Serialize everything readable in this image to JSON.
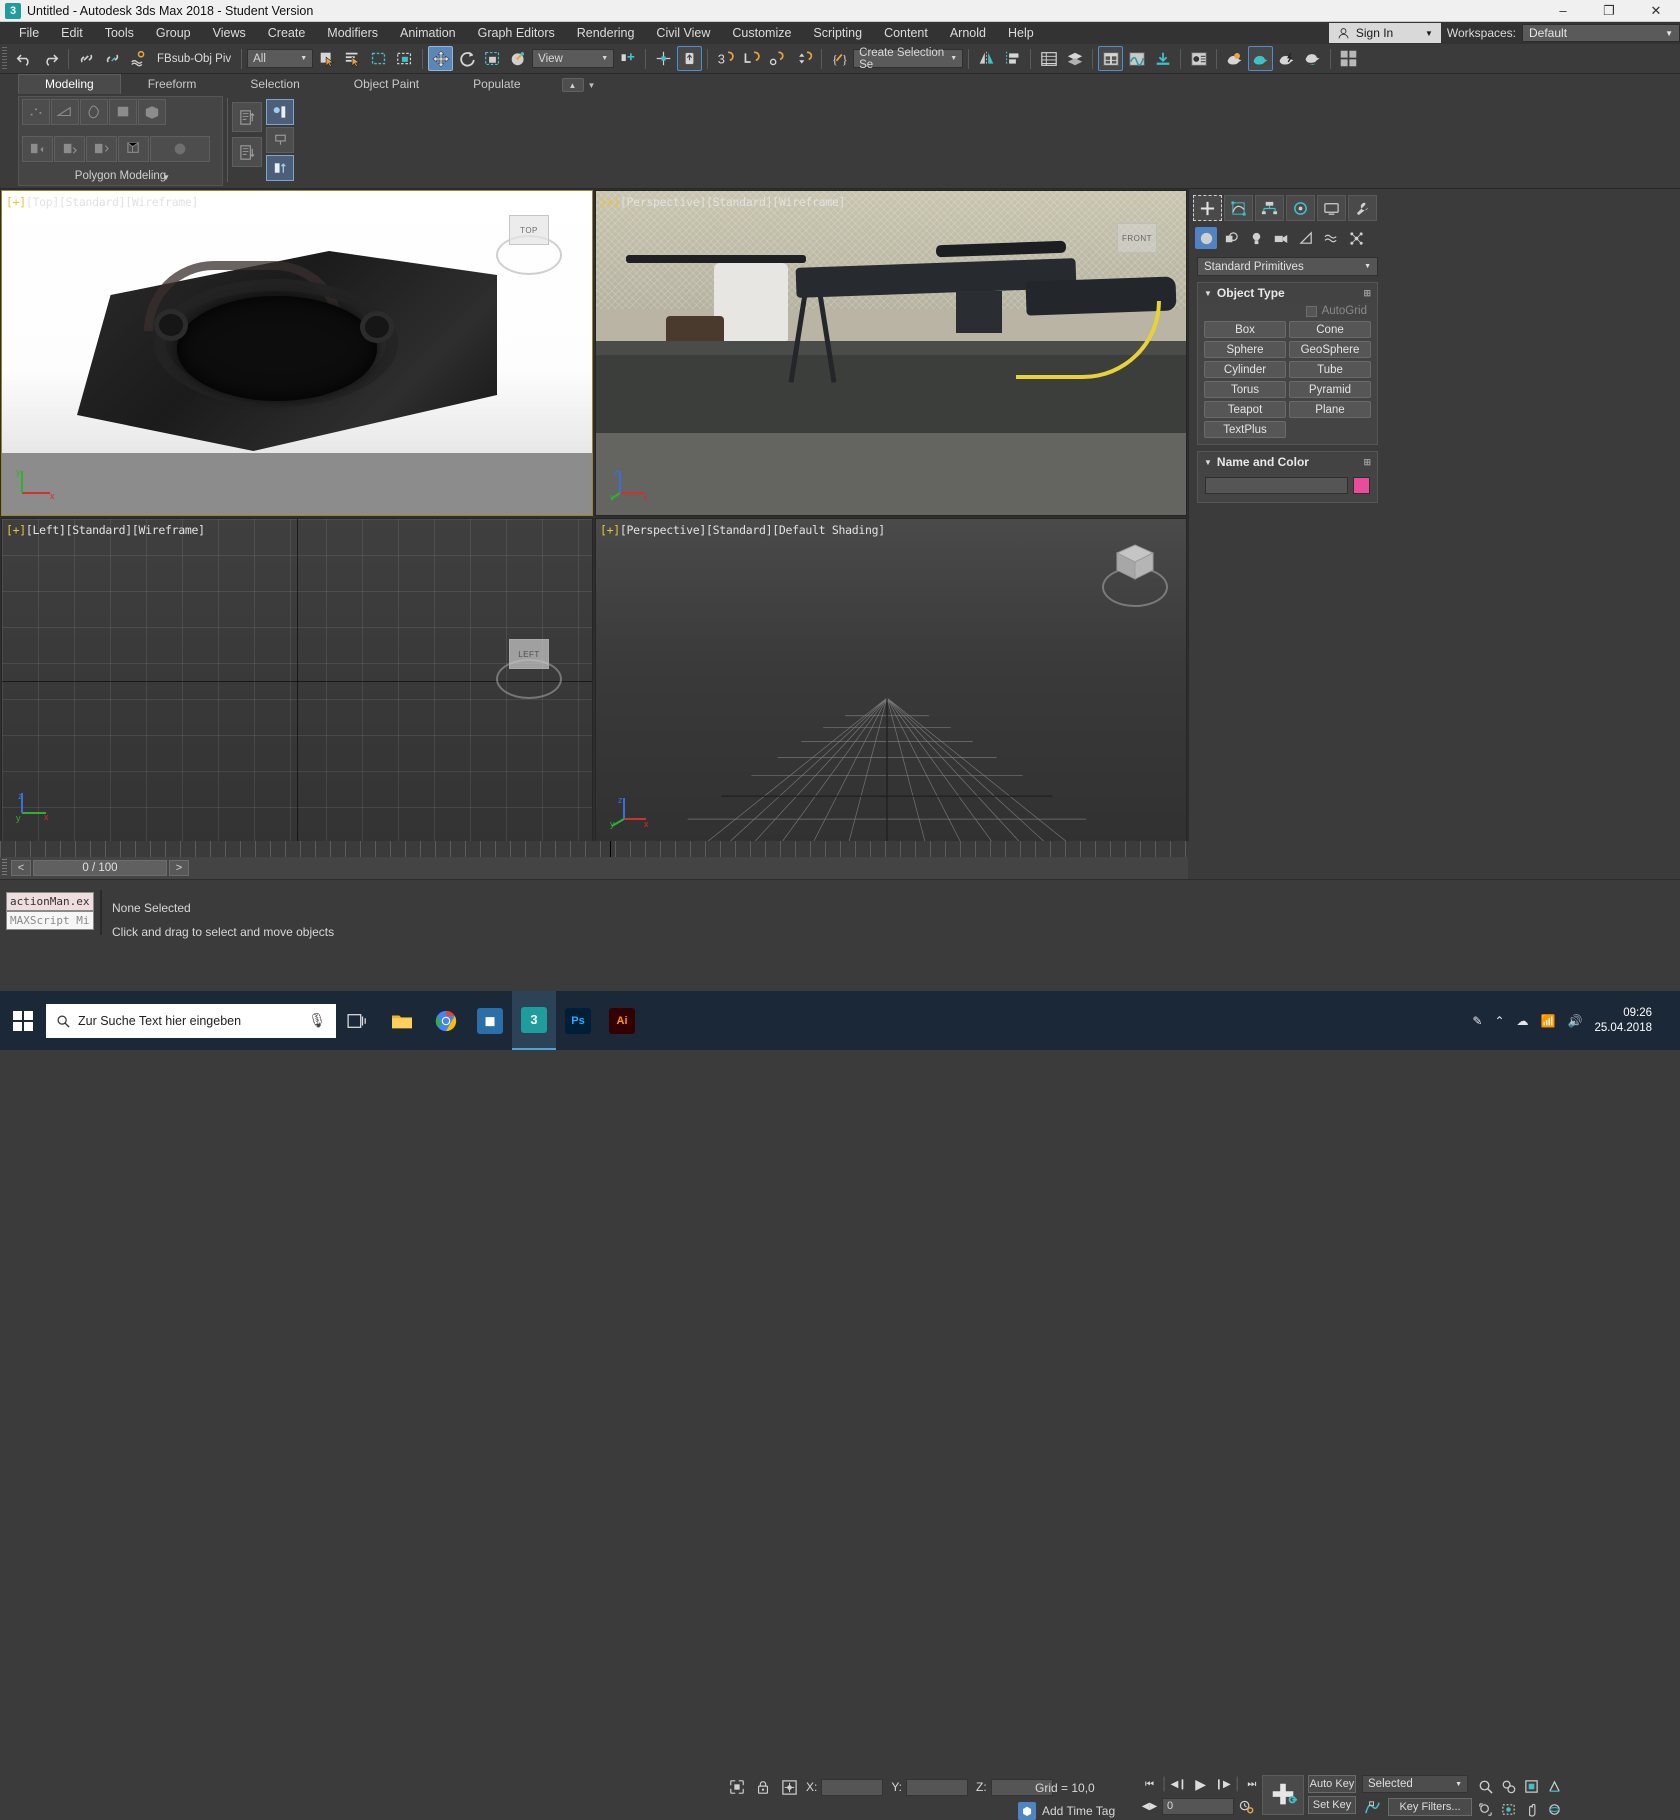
{
  "window": {
    "title": "Untitled - Autodesk 3ds Max 2018 - Student Version",
    "app_icon": "3ds-max-icon",
    "minimize": "–",
    "maximize": "❐",
    "close": "✕"
  },
  "menubar": {
    "items": [
      "File",
      "Edit",
      "Tools",
      "Group",
      "Views",
      "Create",
      "Modifiers",
      "Animation",
      "Graph Editors",
      "Rendering",
      "Civil View",
      "Customize",
      "Scripting",
      "Content",
      "Arnold",
      "Help"
    ],
    "sign_in": "Sign In",
    "workspaces_label": "Workspaces:",
    "workspace_value": "Default"
  },
  "toolbar": {
    "undo": "undo-icon",
    "redo": "redo-icon",
    "select_link": "select-and-link-icon",
    "unlink": "unlink-selection-icon",
    "bind_space_warp": "bind-to-space-warp-icon",
    "named_set_label": "FBsub-Obj Piv",
    "filter_value": "All",
    "select_object": "select-object-icon",
    "select_by_name": "select-by-name-icon",
    "rect_select": "rectangular-selection-region-icon",
    "window_crossing": "window-crossing-icon",
    "select_move": "select-and-move-icon",
    "select_rotate": "select-and-rotate-icon",
    "select_scale": "select-and-uniform-scale-icon",
    "placement": "placement-tool-icon",
    "ref_coord_value": "View",
    "use_center": "use-pivot-point-center-icon",
    "select_snap_toggle": "snaps-toggle-icon",
    "angle_snap": "angle-snap-toggle-icon",
    "percent_snap": "percent-snap-toggle-icon",
    "spinner_snap": "spinner-snap-toggle-icon",
    "edit_named_sets": "edit-named-selection-sets-icon",
    "selection_set_value": "Create Selection Se",
    "mirror": "mirror-icon",
    "align": "align-icon",
    "layer_explorer": "layer-explorer-icon",
    "scene_explorer": "scene-explorer-icon",
    "curve_editor": "curve-editor-icon",
    "schematic_view": "schematic-view-icon",
    "material_editor": "material-editor-icon",
    "render_setup": "render-setup-icon",
    "render_frame": "rendered-frame-window-icon",
    "render_production": "render-production-icon",
    "render_iterative": "render-iterative-icon",
    "active_shade": "active-shade-icon",
    "render_in_place": "render-in-place-icon"
  },
  "ribbon": {
    "tabs": [
      {
        "label": "Modeling",
        "active": true
      },
      {
        "label": "Freeform",
        "active": false
      },
      {
        "label": "Selection",
        "active": false
      },
      {
        "label": "Object Paint",
        "active": false
      },
      {
        "label": "Populate",
        "active": false
      }
    ],
    "panel_title": "Polygon Modeling",
    "subobject_icons": [
      "vertex-icon",
      "edge-icon",
      "border-icon",
      "polygon-icon",
      "element-icon"
    ],
    "action_icons": [
      "generate-topology-icon",
      "repeat-last-icon",
      "swift-loop-icon",
      "paint-connect-icon",
      "nurms-subdivision-icon"
    ],
    "column_icons": [
      "apply-up-icon",
      "apply-down-icon"
    ],
    "toggle_icons": [
      "show-cage-icon",
      "pin-stack-icon",
      "preserve-uvs-icon"
    ]
  },
  "viewports": [
    {
      "id": "top",
      "label_plus": "[+]",
      "label_rest": "[Top][Standard][Wireframe]",
      "active": true,
      "nav_cube": "TOP",
      "content": "photo-black-bracket"
    },
    {
      "id": "perspective-wire",
      "label_plus": "[+]",
      "label_rest": "[Perspective][Standard][Wireframe]",
      "active": false,
      "nav_cube": "FRONT",
      "content": "photo-rifle-on-table"
    },
    {
      "id": "left",
      "label_plus": "[+]",
      "label_rest": "[Left][Standard][Wireframe]",
      "active": false,
      "nav_cube": "LEFT",
      "content": "empty-grid"
    },
    {
      "id": "perspective-shaded",
      "label_plus": "[+]",
      "label_rest": "[Perspective][Standard][Default Shading]",
      "active": false,
      "nav_cube": "CUBE",
      "content": "perspective-grid"
    }
  ],
  "command_panel": {
    "tabs": [
      "create-tab-icon",
      "modify-tab-icon",
      "hierarchy-tab-icon",
      "motion-tab-icon",
      "display-tab-icon",
      "utilities-tab-icon"
    ],
    "active_tab_index": 0,
    "subtabs": [
      "geometry-icon",
      "shapes-icon",
      "lights-icon",
      "cameras-icon",
      "helpers-icon",
      "space-warps-icon",
      "systems-icon"
    ],
    "active_subtab_index": 0,
    "category_value": "Standard Primitives",
    "object_type": {
      "title": "Object Type",
      "autogrid_label": "AutoGrid",
      "buttons": [
        "Box",
        "Cone",
        "Sphere",
        "GeoSphere",
        "Cylinder",
        "Tube",
        "Torus",
        "Pyramid",
        "Teapot",
        "Plane",
        "TextPlus"
      ]
    },
    "name_and_color": {
      "title": "Name and Color",
      "name_value": "",
      "color": "#e84d9c"
    }
  },
  "trackbar": {
    "prev_label": "<",
    "next_label": ">",
    "frame_display": "0 / 100"
  },
  "statusbar": {
    "maxscript_line1": "actionMan.ex",
    "maxscript_line2": "MAXScript Mi",
    "selection_status": "None Selected",
    "prompt": "Click and drag to select and move objects",
    "selection_lock_icon": "selection-lock-icon",
    "lock_icon": "lock-icon",
    "absolute_mode_icon": "absolute-relative-transform-icon",
    "x_label": "X:",
    "x_value": "",
    "y_label": "Y:",
    "y_value": "",
    "z_label": "Z:",
    "z_value": "",
    "grid_text": "Grid = 10,0",
    "add_time_tag": "Add Time Tag"
  },
  "animation": {
    "goto_start": "⏮",
    "prev_frame": "◀❙",
    "play": "▶",
    "next_frame": "❙▶",
    "goto_end": "⏭",
    "key_mode_icon": "key-mode-toggle-icon",
    "current_frame": "0",
    "time_config_icon": "time-configuration-icon",
    "set_key_plus_icon": "set-keys-icon",
    "auto_key": "Auto Key",
    "set_key": "Set Key",
    "filter_value": "Selected",
    "key_filters": "Key Filters...",
    "key_tangent_icon": "default-in-out-tangents-icon",
    "nav_icons": [
      "zoom-icon",
      "zoom-all-icon",
      "zoom-extents-icon",
      "zoom-region-icon",
      "pan-icon",
      "orbit-icon",
      "maximize-viewport-icon",
      "field-of-view-icon"
    ]
  },
  "taskbar": {
    "start": "windows-start-icon",
    "search_placeholder": "Zur Suche Text hier eingeben",
    "mic_icon": "microphone-icon",
    "apps": [
      {
        "name": "task-view-icon",
        "label": "▭",
        "color": "transparent"
      },
      {
        "name": "file-explorer-icon",
        "label": "🗁",
        "color": "#f0b429"
      },
      {
        "name": "chrome-icon",
        "label": "◉",
        "color": "#4285f4"
      },
      {
        "name": "photoshop-alt-icon",
        "label": "■",
        "color": "#2a6fa8"
      },
      {
        "name": "3ds-max-icon",
        "label": "3",
        "color": "#1f9c9c"
      },
      {
        "name": "photoshop-icon",
        "label": "Ps",
        "color": "#001e36"
      },
      {
        "name": "illustrator-icon",
        "label": "Ai",
        "color": "#330000"
      }
    ],
    "active_app_index": 4,
    "tray_icons": [
      "pen-icon",
      "chevron-up-icon",
      "onedrive-icon",
      "network-icon",
      "volume-icon"
    ],
    "clock_time": "09:26",
    "clock_date": "25.04.2018"
  }
}
